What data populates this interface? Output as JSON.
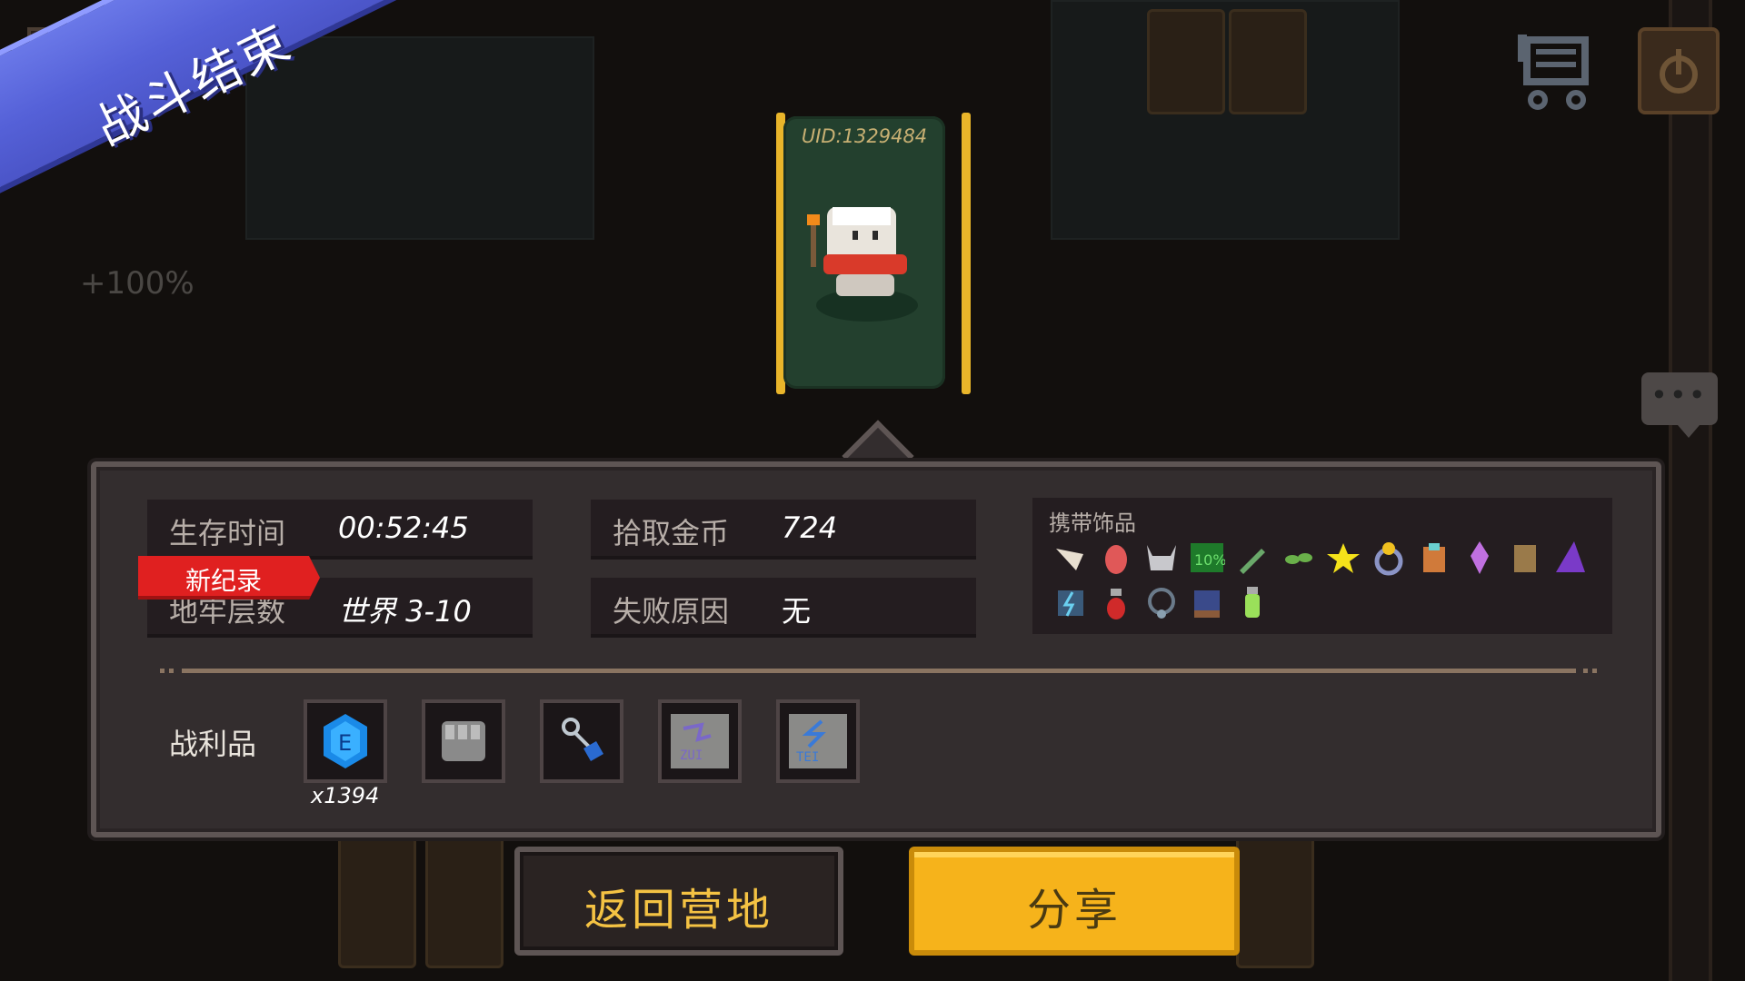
{
  "banner": {
    "title": "战斗结束"
  },
  "background": {
    "bonus_text": "+100%"
  },
  "character_card": {
    "uid": "UID:1329484"
  },
  "stats": {
    "survival_time": {
      "label": "生存时间",
      "value": "00:52:45"
    },
    "gold_collected": {
      "label": "拾取金币",
      "value": "724"
    },
    "dungeon_level": {
      "label": "地牢层数",
      "value": "世界 3-10"
    },
    "failure_reason": {
      "label": "失败原因",
      "value": "无"
    },
    "new_record_badge": "新纪录"
  },
  "accessories": {
    "title": "携带饰品",
    "icons": [
      "horn-icon",
      "meat-icon",
      "horned-helmet-icon",
      "ten-percent-banner-icon",
      "green-dagger-icon",
      "leaf-sprout-icon",
      "yellow-star-icon",
      "gold-ring-icon",
      "spiked-armor-icon",
      "crystal-icon",
      "scroll-case-icon",
      "purple-hat-icon",
      "lightning-rune-icon",
      "red-potion-icon",
      "stone-amulet-icon",
      "spell-book-icon",
      "green-potion-icon"
    ]
  },
  "loot": {
    "label": "战利品",
    "items": [
      {
        "icon": "blue-energy-gem-icon",
        "count": "x1394"
      },
      {
        "icon": "iron-gauntlet-icon"
      },
      {
        "icon": "blue-key-icon"
      },
      {
        "icon": "rune-tablet-purple-icon"
      },
      {
        "icon": "rune-tablet-blue-icon"
      }
    ]
  },
  "buttons": {
    "return_camp": "返回营地",
    "share": "分享"
  },
  "colors": {
    "banner": "#5561d8",
    "share_button": "#f6b31b",
    "record_badge": "#e02020",
    "card_frame": "#e9b52a"
  }
}
